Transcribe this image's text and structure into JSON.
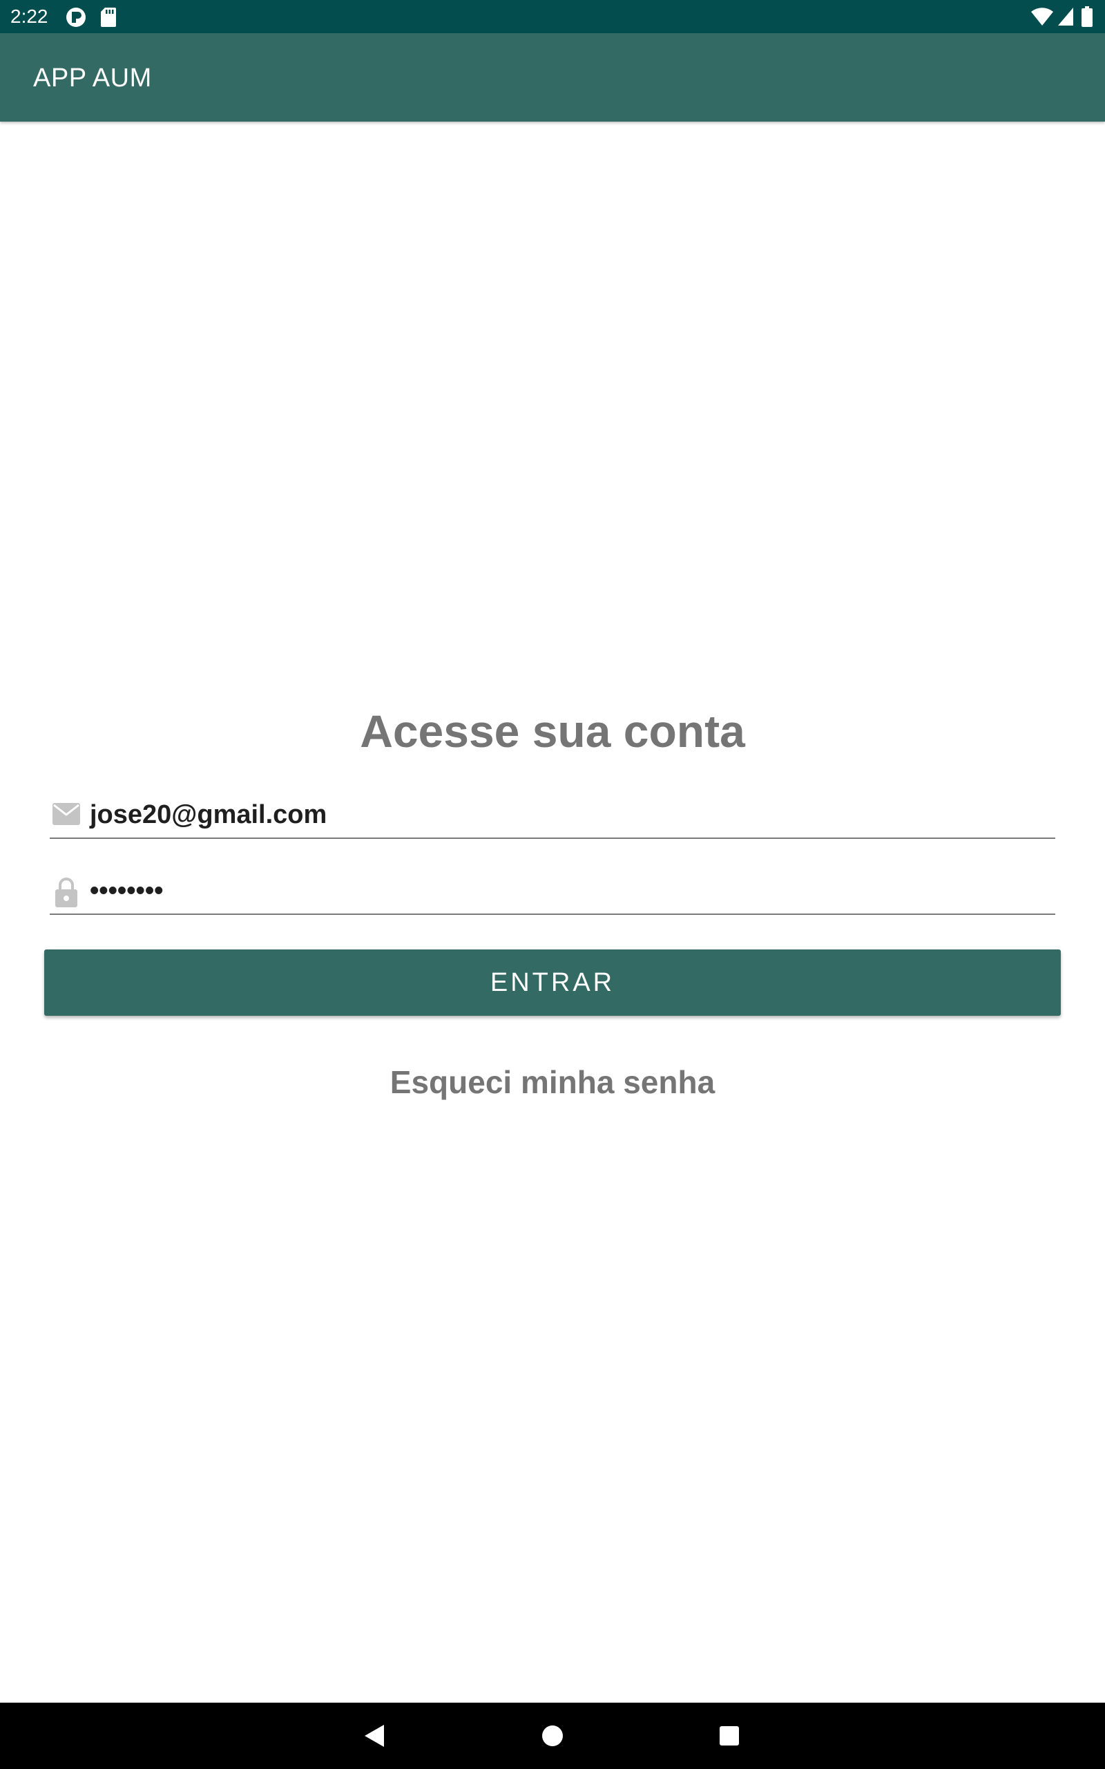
{
  "status_bar": {
    "time": "2:22",
    "icons": [
      "app-notification-icon",
      "sd-card-icon",
      "wifi-icon",
      "cell-signal-icon",
      "battery-icon"
    ]
  },
  "app_bar": {
    "title": "APP AUM",
    "color": "#336a63"
  },
  "login": {
    "heading": "Acesse sua conta",
    "email": {
      "icon": "email-icon",
      "value": "jose20@gmail.com"
    },
    "password": {
      "icon": "lock-icon",
      "value": "••••••••"
    },
    "submit_label": "ENTRAR",
    "forgot_password_label": "Esqueci minha senha"
  },
  "nav_bar": {
    "icons": [
      "back-icon",
      "home-icon",
      "recents-icon"
    ]
  },
  "colors": {
    "status_bar": "#034d4f",
    "primary": "#336a63",
    "secondary_text": "#757575"
  }
}
